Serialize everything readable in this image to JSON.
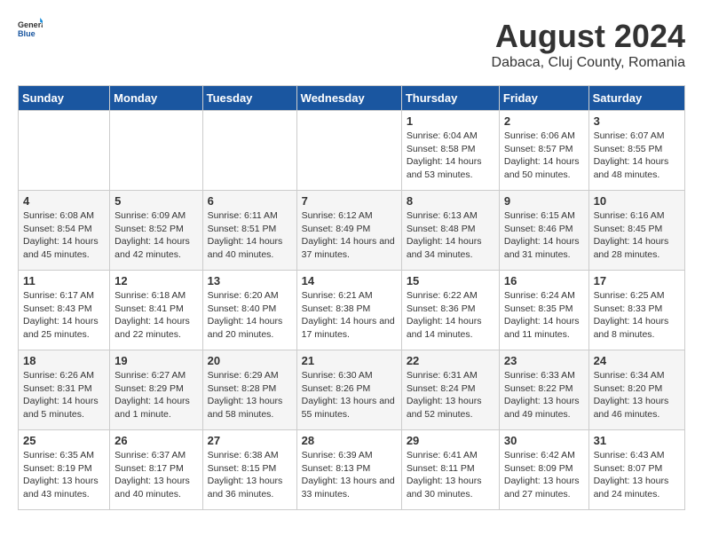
{
  "logo": {
    "text1": "General",
    "text2": "Blue"
  },
  "title": "August 2024",
  "subtitle": "Dabaca, Cluj County, Romania",
  "weekdays": [
    "Sunday",
    "Monday",
    "Tuesday",
    "Wednesday",
    "Thursday",
    "Friday",
    "Saturday"
  ],
  "weeks": [
    [
      {
        "day": "",
        "info": ""
      },
      {
        "day": "",
        "info": ""
      },
      {
        "day": "",
        "info": ""
      },
      {
        "day": "",
        "info": ""
      },
      {
        "day": "1",
        "info": "Sunrise: 6:04 AM\nSunset: 8:58 PM\nDaylight: 14 hours and 53 minutes."
      },
      {
        "day": "2",
        "info": "Sunrise: 6:06 AM\nSunset: 8:57 PM\nDaylight: 14 hours and 50 minutes."
      },
      {
        "day": "3",
        "info": "Sunrise: 6:07 AM\nSunset: 8:55 PM\nDaylight: 14 hours and 48 minutes."
      }
    ],
    [
      {
        "day": "4",
        "info": "Sunrise: 6:08 AM\nSunset: 8:54 PM\nDaylight: 14 hours and 45 minutes."
      },
      {
        "day": "5",
        "info": "Sunrise: 6:09 AM\nSunset: 8:52 PM\nDaylight: 14 hours and 42 minutes."
      },
      {
        "day": "6",
        "info": "Sunrise: 6:11 AM\nSunset: 8:51 PM\nDaylight: 14 hours and 40 minutes."
      },
      {
        "day": "7",
        "info": "Sunrise: 6:12 AM\nSunset: 8:49 PM\nDaylight: 14 hours and 37 minutes."
      },
      {
        "day": "8",
        "info": "Sunrise: 6:13 AM\nSunset: 8:48 PM\nDaylight: 14 hours and 34 minutes."
      },
      {
        "day": "9",
        "info": "Sunrise: 6:15 AM\nSunset: 8:46 PM\nDaylight: 14 hours and 31 minutes."
      },
      {
        "day": "10",
        "info": "Sunrise: 6:16 AM\nSunset: 8:45 PM\nDaylight: 14 hours and 28 minutes."
      }
    ],
    [
      {
        "day": "11",
        "info": "Sunrise: 6:17 AM\nSunset: 8:43 PM\nDaylight: 14 hours and 25 minutes."
      },
      {
        "day": "12",
        "info": "Sunrise: 6:18 AM\nSunset: 8:41 PM\nDaylight: 14 hours and 22 minutes."
      },
      {
        "day": "13",
        "info": "Sunrise: 6:20 AM\nSunset: 8:40 PM\nDaylight: 14 hours and 20 minutes."
      },
      {
        "day": "14",
        "info": "Sunrise: 6:21 AM\nSunset: 8:38 PM\nDaylight: 14 hours and 17 minutes."
      },
      {
        "day": "15",
        "info": "Sunrise: 6:22 AM\nSunset: 8:36 PM\nDaylight: 14 hours and 14 minutes."
      },
      {
        "day": "16",
        "info": "Sunrise: 6:24 AM\nSunset: 8:35 PM\nDaylight: 14 hours and 11 minutes."
      },
      {
        "day": "17",
        "info": "Sunrise: 6:25 AM\nSunset: 8:33 PM\nDaylight: 14 hours and 8 minutes."
      }
    ],
    [
      {
        "day": "18",
        "info": "Sunrise: 6:26 AM\nSunset: 8:31 PM\nDaylight: 14 hours and 5 minutes."
      },
      {
        "day": "19",
        "info": "Sunrise: 6:27 AM\nSunset: 8:29 PM\nDaylight: 14 hours and 1 minute."
      },
      {
        "day": "20",
        "info": "Sunrise: 6:29 AM\nSunset: 8:28 PM\nDaylight: 13 hours and 58 minutes."
      },
      {
        "day": "21",
        "info": "Sunrise: 6:30 AM\nSunset: 8:26 PM\nDaylight: 13 hours and 55 minutes."
      },
      {
        "day": "22",
        "info": "Sunrise: 6:31 AM\nSunset: 8:24 PM\nDaylight: 13 hours and 52 minutes."
      },
      {
        "day": "23",
        "info": "Sunrise: 6:33 AM\nSunset: 8:22 PM\nDaylight: 13 hours and 49 minutes."
      },
      {
        "day": "24",
        "info": "Sunrise: 6:34 AM\nSunset: 8:20 PM\nDaylight: 13 hours and 46 minutes."
      }
    ],
    [
      {
        "day": "25",
        "info": "Sunrise: 6:35 AM\nSunset: 8:19 PM\nDaylight: 13 hours and 43 minutes."
      },
      {
        "day": "26",
        "info": "Sunrise: 6:37 AM\nSunset: 8:17 PM\nDaylight: 13 hours and 40 minutes."
      },
      {
        "day": "27",
        "info": "Sunrise: 6:38 AM\nSunset: 8:15 PM\nDaylight: 13 hours and 36 minutes."
      },
      {
        "day": "28",
        "info": "Sunrise: 6:39 AM\nSunset: 8:13 PM\nDaylight: 13 hours and 33 minutes."
      },
      {
        "day": "29",
        "info": "Sunrise: 6:41 AM\nSunset: 8:11 PM\nDaylight: 13 hours and 30 minutes."
      },
      {
        "day": "30",
        "info": "Sunrise: 6:42 AM\nSunset: 8:09 PM\nDaylight: 13 hours and 27 minutes."
      },
      {
        "day": "31",
        "info": "Sunrise: 6:43 AM\nSunset: 8:07 PM\nDaylight: 13 hours and 24 minutes."
      }
    ]
  ]
}
